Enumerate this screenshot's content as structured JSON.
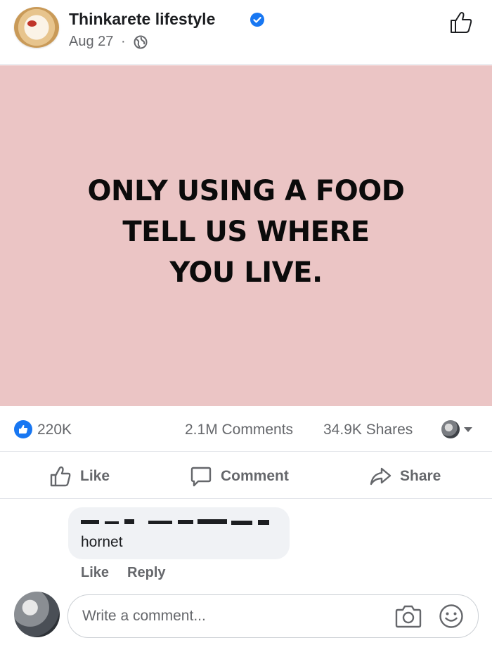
{
  "post": {
    "author": "Thinkarete lifestyle",
    "date": "Aug 27",
    "date_separator": "·",
    "image_text_lines": [
      "ONLY USING A FOOD",
      "TELL US WHERE",
      "YOU LIVE."
    ],
    "image_bg_color": "#ebc5c5"
  },
  "stats": {
    "likes": "220K",
    "comments": "2.1M Comments",
    "shares": "34.9K Shares"
  },
  "actions": {
    "like": "Like",
    "comment": "Comment",
    "share": "Share"
  },
  "comment": {
    "text": "hornet",
    "like": "Like",
    "reply": "Reply"
  },
  "composer": {
    "placeholder": "Write a comment..."
  },
  "icons": [
    "verified-badge-icon",
    "globe-icon",
    "thumbs-up-icon",
    "comment-icon",
    "share-icon",
    "camera-icon",
    "smile-icon"
  ],
  "colors": {
    "facebook_blue": "#1877f2",
    "text_secondary": "#65676b"
  }
}
